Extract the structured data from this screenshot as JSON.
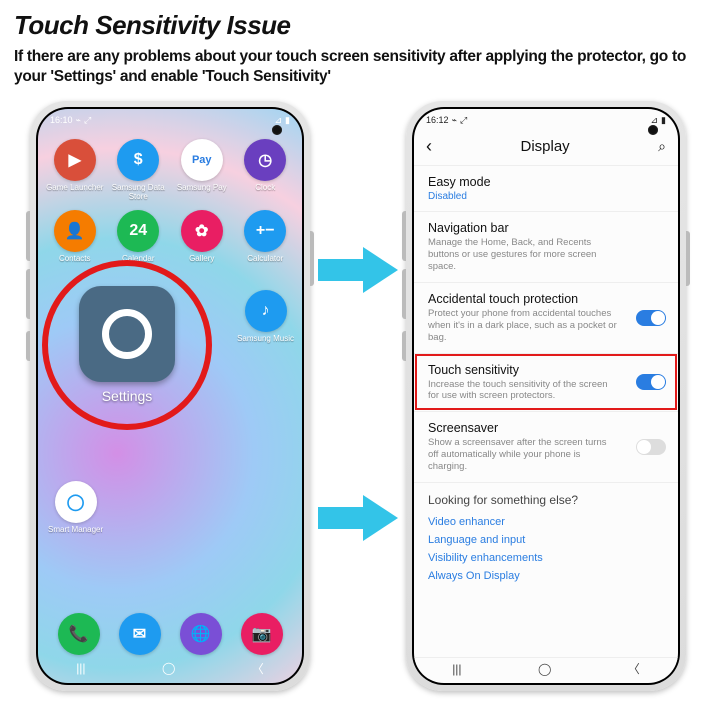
{
  "header": {
    "title": "Touch Sensitivity Issue",
    "subtitle": "If there are any problems about your touch screen sensitivity after applying the protector, go to your 'Settings' and enable 'Touch Sensitivity'"
  },
  "left": {
    "status_time": "16:10",
    "apps_row1": [
      {
        "label": "Game Launcher",
        "color": "#d94f3a",
        "glyph": "▶"
      },
      {
        "label": "Samsung Data Store",
        "color": "#1e9bf0",
        "glyph": "$"
      },
      {
        "label": "Samsung Pay",
        "color": "#fff",
        "glyph": "Pay",
        "text": "#2a7de1"
      },
      {
        "label": "Clock",
        "color": "#6a3fbf",
        "glyph": "◷"
      }
    ],
    "apps_row2": [
      {
        "label": "Contacts",
        "color": "#f57c00",
        "glyph": "👤"
      },
      {
        "label": "Calendar",
        "color": "#1db954",
        "glyph": "24"
      },
      {
        "label": "Gallery",
        "color": "#e91e63",
        "glyph": "✿"
      },
      {
        "label": "Calculator",
        "color": "#1e9bf0",
        "glyph": "+−"
      }
    ],
    "settings_label": "Settings",
    "music": {
      "label": "Samsung Music",
      "color": "#1e9bf0",
      "glyph": "♪"
    },
    "smart": {
      "label": "Smart Manager",
      "color": "#fff",
      "glyph": "◯",
      "text": "#1e9bf0"
    },
    "dock": [
      {
        "color": "#1db954",
        "glyph": "📞"
      },
      {
        "color": "#1e9bf0",
        "glyph": "✉"
      },
      {
        "color": "#7a4fd6",
        "glyph": "🌐"
      },
      {
        "color": "#e91e63",
        "glyph": "📷"
      }
    ]
  },
  "right": {
    "status_time": "16:12",
    "screen_title": "Display",
    "items": [
      {
        "label": "Easy mode",
        "value": "Disabled"
      },
      {
        "label": "Navigation bar",
        "sub": "Manage the Home, Back, and Recents buttons or use gestures for more screen space."
      },
      {
        "label": "Accidental touch protection",
        "sub": "Protect your phone from accidental touches when it's in a dark place, such as a pocket or bag.",
        "toggle": "on"
      },
      {
        "label": "Touch sensitivity",
        "sub": "Increase the touch sensitivity of the screen for use with screen protectors.",
        "toggle": "on",
        "highlight": true
      },
      {
        "label": "Screensaver",
        "sub": "Show a screensaver after the screen turns off automatically while your phone is charging.",
        "toggle": "off"
      }
    ],
    "footer_title": "Looking for something else?",
    "footer_links": [
      "Video enhancer",
      "Language and input",
      "Visibility enhancements",
      "Always On Display"
    ]
  }
}
